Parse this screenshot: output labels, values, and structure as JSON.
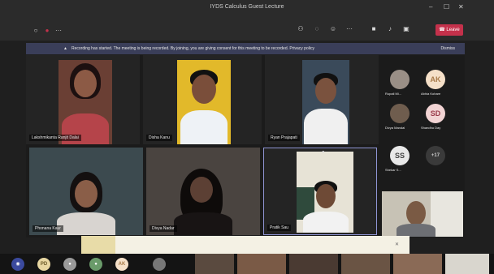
{
  "window": {
    "title": "IYDS Calculus Guest Lecture",
    "minimize": "–",
    "maximize": "☐",
    "close": "✕"
  },
  "toolbar": {
    "leave_label": "Leave"
  },
  "banner": {
    "text": "Recording has started. The meeting is being recorded. By joining, you are giving consent for this meeting to be recorded. Privacy policy",
    "dismiss_label": "Dismiss"
  },
  "participants": [
    {
      "name": "Lakshmikanta Ranjit Dalai"
    },
    {
      "name": "Disha Kanu"
    },
    {
      "name": "Ryan Prajapati"
    },
    {
      "name": "Phonana Kaur"
    },
    {
      "name": "Divya Nadar"
    },
    {
      "name": "Pratik Sau"
    }
  ],
  "sidebar": [
    {
      "name": "Rupali Mi...",
      "initials": ""
    },
    {
      "name": "Abhia Kohare",
      "initials": "AK"
    },
    {
      "name": "Divya Mandal",
      "initials": ""
    },
    {
      "name": "Shandhu Day",
      "initials": "SD"
    },
    {
      "name": "Shekar S...",
      "initials": "SS"
    },
    {
      "name": "",
      "initials": "+17"
    }
  ],
  "taskbar": {
    "items": [
      "PD",
      "AK"
    ]
  },
  "colors": {
    "accent": "#c4314b",
    "banner": "#3a3e59",
    "avatar_ak": "#f5e0c8",
    "avatar_sd": "#f2d4d4",
    "avatar_ss": "#e8e8e8"
  }
}
